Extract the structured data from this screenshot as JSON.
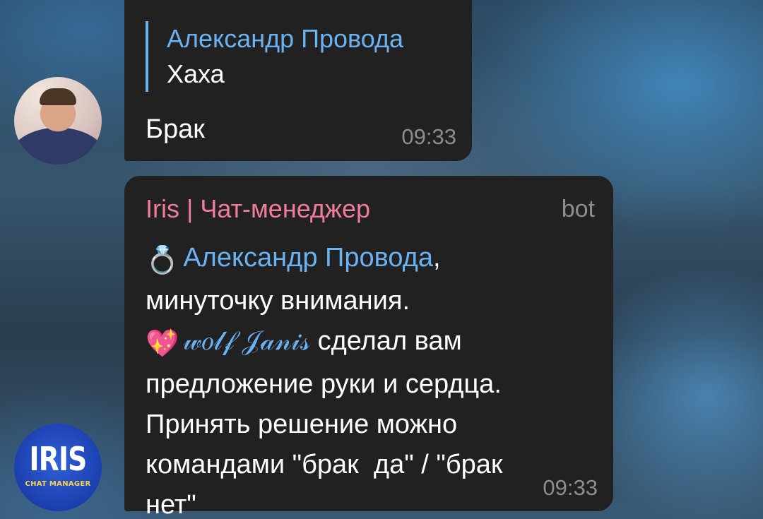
{
  "chat": {
    "messages": [
      {
        "reply_to": {
          "name": "Александр Провода",
          "text": "Хаха"
        },
        "text": "Брак",
        "time": "09:33",
        "avatar_icon": "user-photo"
      },
      {
        "sender": "Iris | Чат-менеджер",
        "bot_tag": "bot",
        "line1_emoji": "💍",
        "mention": "Александр Провода",
        "line1_suffix": ",",
        "line2": "минуточку внимания.",
        "line3_emoji": "💖",
        "proposer": "𝓌𝑜𝓁𝒻 𝒥𝒶𝓃𝒾𝓈",
        "line3_rest": "сделал вам",
        "line4": "предложение руки и сердца.",
        "line5": "Принять решение можно",
        "line6": "командами \"брак  да\" / \"брак",
        "line7": "нет\"",
        "time": "09:33",
        "avatar": {
          "logo": "IRIS",
          "subtitle": "CHAT MANAGER"
        }
      }
    ]
  },
  "colors": {
    "bubble": "#212121",
    "link": "#6ab2f2",
    "bot_name": "#f27c9c",
    "time": "#8d8d8d"
  }
}
